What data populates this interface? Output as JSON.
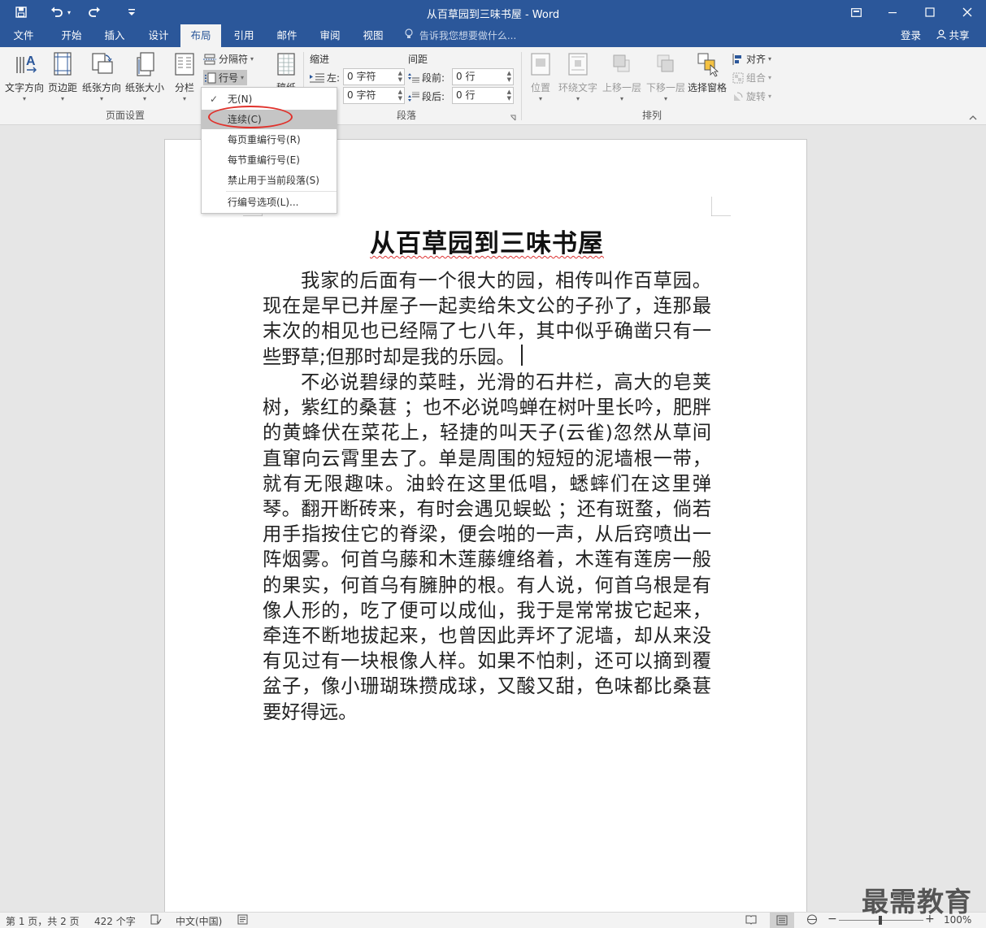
{
  "titlebar": {
    "title": "从百草园到三味书屋 - Word",
    "qat": {
      "save_icon": "save-icon",
      "undo_icon": "undo-icon",
      "redo_icon": "redo-icon",
      "customize_icon": "customize-qat-icon"
    },
    "window_controls": [
      "ribbon-display-icon",
      "minimize-icon",
      "maximize-icon",
      "close-icon"
    ]
  },
  "tabs": {
    "items": [
      "文件",
      "开始",
      "插入",
      "设计",
      "布局",
      "引用",
      "邮件",
      "审阅",
      "视图"
    ],
    "active": "布局",
    "tell_me": "告诉我您想要做什么...",
    "login": "登录",
    "share": "共享"
  },
  "ribbon": {
    "page_setup": {
      "text_direction": "文字方向",
      "margins": "页边距",
      "orientation": "纸张方向",
      "size": "纸张大小",
      "columns": "分栏",
      "breaks": "分隔符",
      "line_numbers": "行号",
      "group_label": "页面设置"
    },
    "manuscript": {
      "label": "稿纸"
    },
    "paragraph": {
      "indent_label": "缩进",
      "spacing_label": "间距",
      "left_label": "左:",
      "left_value": "0 字符",
      "right_value": "0 字符",
      "before_label": "段前:",
      "before_value": "0 行",
      "after_label": "段后:",
      "after_value": "0 行",
      "group_label": "段落"
    },
    "arrange": {
      "position": "位置",
      "wrap_text": "环绕文字",
      "bring_forward": "上移一层",
      "send_backward": "下移一层",
      "selection_pane": "选择窗格",
      "align": "对齐",
      "group": "组合",
      "rotate": "旋转",
      "group_label": "排列"
    }
  },
  "line_numbers_menu": {
    "items": [
      "无(N)",
      "连续(C)",
      "每页重编行号(R)",
      "每节重编行号(E)",
      "禁止用于当前段落(S)",
      "行编号选项(L)..."
    ],
    "checked": "无(N)",
    "highlighted": "连续(C)"
  },
  "document": {
    "title": "从百草园到三味书屋",
    "paragraphs": [
      "我家的后面有一个很大的园，相传叫作百草园。现在是早已并屋子一起卖给朱文公的子孙了，连那最末次的相见也已经隔了七八年，其中似乎确凿只有一些野草;但那时却是我的乐园。",
      "不必说碧绿的菜畦，光滑的石井栏，高大的皂荚树，紫红的桑葚 ；也不必说鸣蝉在树叶里长吟，肥胖的黄蜂伏在菜花上，轻捷的叫天子(云雀)忽然从草间直窜向云霄里去了。单是周围的短短的泥墙根一带，就有无限趣味。油蛉在这里低唱，蟋蟀们在这里弹琴。翻开断砖来，有时会遇见蜈蚣 ；还有斑蝥，倘若用手指按住它的脊梁，便会啪的一声，从后窍喷出一阵烟雾。何首乌藤和木莲藤缠络着，木莲有莲房一般的果实，何首乌有臃肿的根。有人说，何首乌根是有像人形的，吃了便可以成仙，我于是常常拔它起来，牵连不断地拔起来，也曾因此弄坏了泥墙，却从来没有见过有一块根像人样。如果不怕刺，还可以摘到覆盆子，像小珊瑚珠攒成球，又酸又甜，色味都比桑葚要好得远。"
    ]
  },
  "statusbar": {
    "page": "第 1 页，共 2 页",
    "words": "422 个字",
    "language": "中文(中国)",
    "zoom": "100%"
  },
  "watermark": "最需教育",
  "colors": {
    "accent": "#2b579a",
    "ribbon_bg": "#f3f3f3",
    "canvas_bg": "#e6e6e6",
    "highlight": "#c5c5c5",
    "annotation_ring": "#e0312b"
  }
}
